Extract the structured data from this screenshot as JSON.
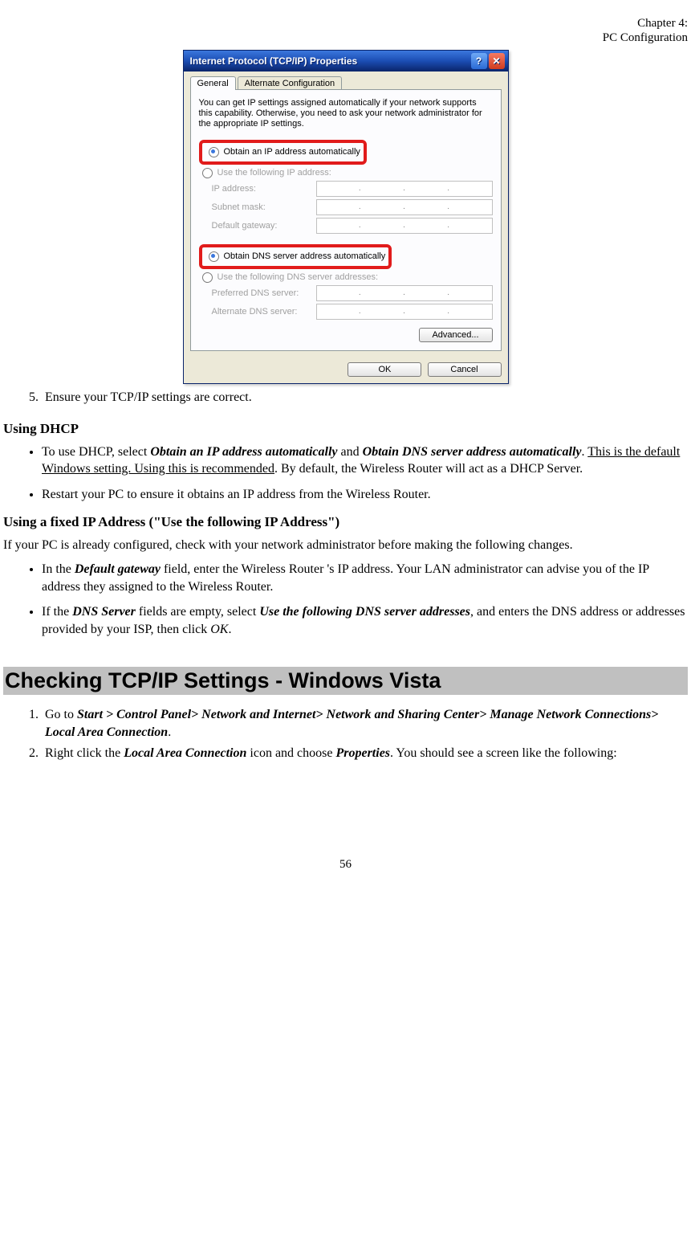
{
  "header": {
    "line1": "Chapter 4:",
    "line2": "PC Configuration"
  },
  "dialog": {
    "title": "Internet Protocol (TCP/IP) Properties",
    "tabs": {
      "general": "General",
      "alt": "Alternate Configuration"
    },
    "intro": "You can get IP settings assigned automatically if your network supports this capability. Otherwise, you need to ask your network administrator for the appropriate IP settings.",
    "opt_obtain_ip": "Obtain an IP address automatically",
    "opt_use_ip": "Use the following IP address:",
    "lbl_ip": "IP address:",
    "lbl_subnet": "Subnet mask:",
    "lbl_gateway": "Default gateway:",
    "opt_obtain_dns": "Obtain DNS server address automatically",
    "opt_use_dns": "Use the following DNS server addresses:",
    "lbl_pref_dns": "Preferred DNS server:",
    "lbl_alt_dns": "Alternate DNS server:",
    "btn_advanced": "Advanced...",
    "btn_ok": "OK",
    "btn_cancel": "Cancel"
  },
  "step5": "Ensure your TCP/IP settings are correct.",
  "dhcp": {
    "heading": "Using DHCP",
    "b1_pre": "To use DHCP, select ",
    "b1_opt1": "Obtain an IP address automatically",
    "b1_and": " and ",
    "b1_opt2": "Obtain DNS server address automatically",
    "b1_period": ". ",
    "b1_ul": "This is the default Windows setting. Using this is recommended",
    "b1_post": ". By default, the Wireless Router will act as a DHCP Server.",
    "b2": "Restart your PC to ensure it obtains an IP address from the Wireless Router."
  },
  "fixed": {
    "heading": "Using a fixed IP Address (\"Use the following IP Address\")",
    "intro": "If your PC is already configured, check with your network administrator before making the following changes.",
    "b1_pre": "In the ",
    "b1_dg": "Default gateway",
    "b1_post": " field, enter the Wireless Router 's IP address. Your LAN administrator can advise you of the IP address they assigned to the Wireless Router.",
    "b2_pre": "If the ",
    "b2_dns": "DNS Server",
    "b2_mid": " fields are empty, select ",
    "b2_use": "Use the following DNS server addresses",
    "b2_post1": ", and enters the DNS address or addresses provided by your ISP, then click ",
    "b2_ok": "OK",
    "b2_post2": "."
  },
  "section": "Checking TCP/IP Settings - Windows Vista",
  "vista": {
    "s1_pre": "Go to ",
    "s1_path": "Start > Control Panel> Network and Internet>  Network and Sharing Center> Manage Network Connections> Local Area Connection",
    "s1_post": ".",
    "s2_pre": "Right click the ",
    "s2_lac": "Local Area Connection",
    "s2_mid": " icon and choose ",
    "s2_props": "Properties",
    "s2_post": ". You should see a screen like the following:"
  },
  "page_number": "56"
}
